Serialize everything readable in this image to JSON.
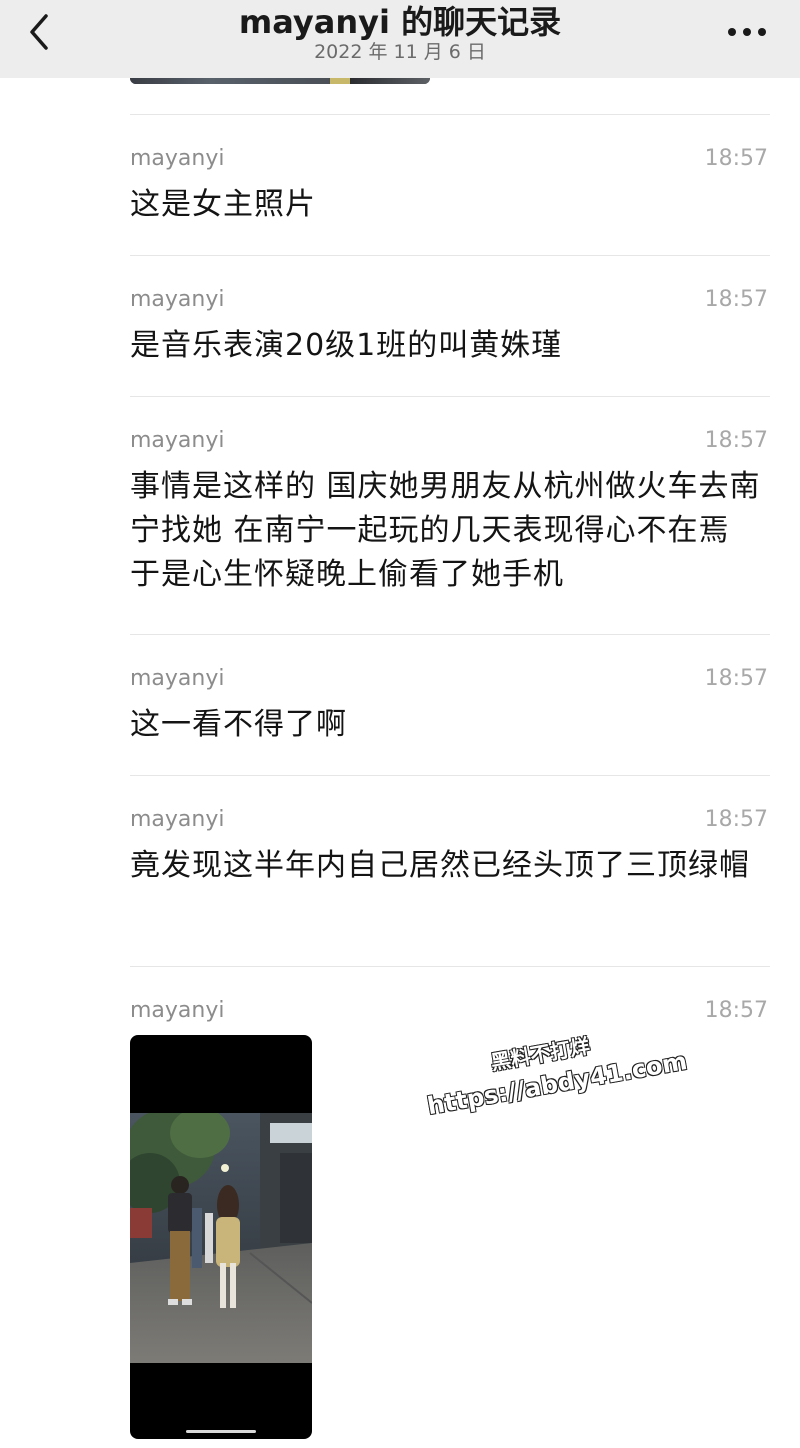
{
  "header": {
    "title": "mayanyi 的聊天记录",
    "subtitle": "2022 年 11 月 6 日"
  },
  "icons": {
    "back": "chevron-left-icon",
    "more": "more-dots-icon"
  },
  "messages": [
    {
      "sender": "mayanyi",
      "time": "18:57",
      "text": "这是女主照片"
    },
    {
      "sender": "mayanyi",
      "time": "18:57",
      "text": "是音乐表演20级1班的叫黄姝瑾"
    },
    {
      "sender": "mayanyi",
      "time": "18:57",
      "text": "事情是这样的 国庆她男朋友从杭州做火车去南宁找她 在南宁一起玩的几天表现得心不在焉  于是心生怀疑晚上偷看了她手机"
    },
    {
      "sender": "mayanyi",
      "time": "18:57",
      "text": "这一看不得了啊"
    },
    {
      "sender": "mayanyi",
      "time": "18:57",
      "text": "竟发现这半年内自己居然已经头顶了三顶绿帽"
    },
    {
      "sender": "mayanyi",
      "time": "18:57",
      "type": "video"
    }
  ],
  "watermark": {
    "line1": "黑料不打烊",
    "line2": "https://abdy41.com"
  },
  "colors": {
    "header_bg": "#ededed",
    "sender": "#8c8c8c",
    "time": "#a8a8a8",
    "text": "#141414",
    "divider": "#e6e6e6"
  }
}
